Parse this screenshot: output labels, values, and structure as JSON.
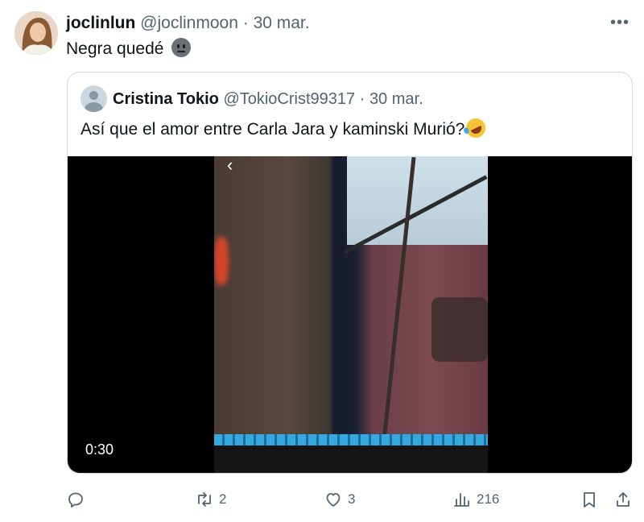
{
  "tweet": {
    "author_name": "joclinlun",
    "author_handle": "@joclinmoon",
    "separator": " · ",
    "date": "30 mar.",
    "text": "Negra quedé",
    "more_label": "•••"
  },
  "quote": {
    "author_name": "Cristina Tokio",
    "author_handle": "@TokioCrist99317",
    "separator": " · ",
    "date": "30 mar.",
    "text": "Así que el amor entre Carla Jara y kaminski Murió?",
    "video_duration": "0:30",
    "back_glyph": "‹"
  },
  "actions": {
    "replies": "",
    "retweets": "2",
    "likes": "3",
    "views": "216"
  },
  "icons": [
    "reply-icon",
    "retweet-icon",
    "like-icon",
    "views-icon",
    "bookmark-icon",
    "share-icon",
    "more-icon"
  ],
  "colors": {
    "text": "#0f1419",
    "muted": "#536471",
    "border": "#cfd9de"
  }
}
